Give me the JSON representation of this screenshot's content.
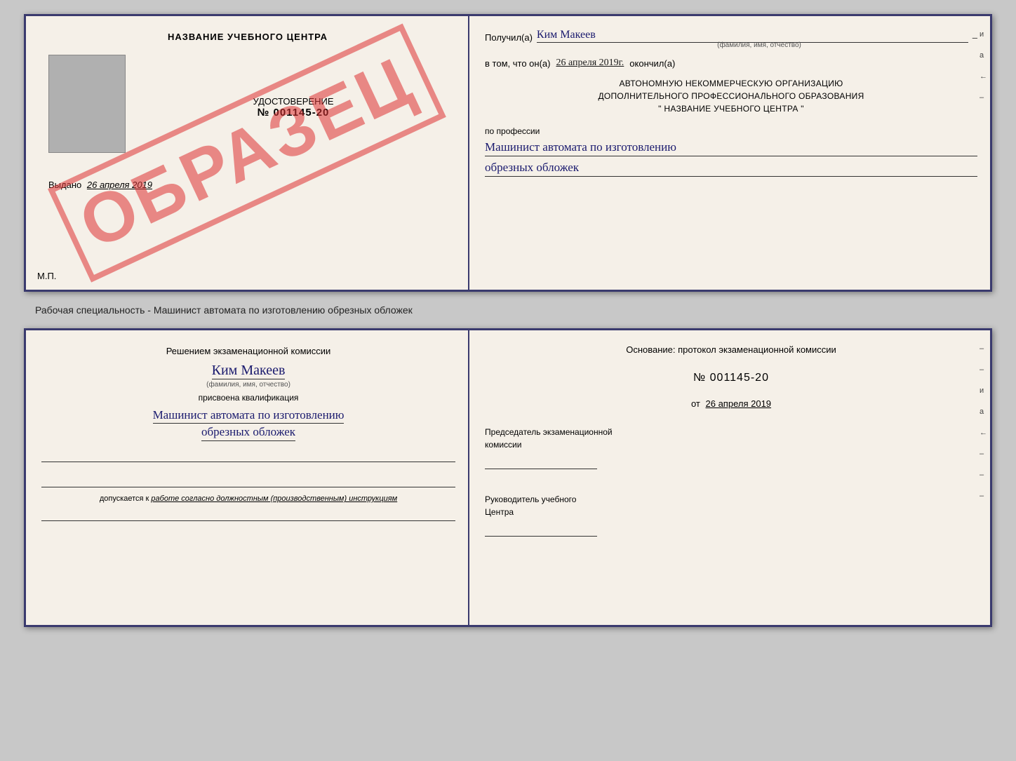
{
  "top_doc": {
    "left": {
      "center_title": "НАЗВАНИЕ УЧЕБНОГО ЦЕНТРА",
      "watermark": "ОБРАЗЕЦ",
      "udostoverenie_label": "УДОСТОВЕРЕНИЕ",
      "number": "№ 001145-20",
      "vydano_label": "Выдано",
      "vydano_date": "26 апреля 2019",
      "mp": "М.П."
    },
    "right": {
      "poluchil_label": "Получил(а)",
      "recipient_name": "Ким Макеев",
      "dash": "–",
      "fio_sub": "(фамилия, имя, отчество)",
      "vtom_label": "в том, что он(а)",
      "date_value": "26 апреля 2019г.",
      "okonchil_label": "окончил(а)",
      "org_line1": "АВТОНОМНУЮ НЕКОММЕРЧЕСКУЮ ОРГАНИЗАЦИЮ",
      "org_line2": "ДОПОЛНИТЕЛЬНОГО ПРОФЕССИОНАЛЬНОГО ОБРАЗОВАНИЯ",
      "org_line3": "\"  НАЗВАНИЕ УЧЕБНОГО ЦЕНТРА  \"",
      "po_professii": "по профессии",
      "profession_line1": "Машинист автомата по изготовлению",
      "profession_line2": "обрезных обложек",
      "dash2": "–",
      "side_marks": [
        "и",
        "а",
        "←",
        "–"
      ]
    }
  },
  "between": {
    "text": "Рабочая специальность - Машинист автомата по изготовлению обрезных обложек"
  },
  "bottom_doc": {
    "left": {
      "komissia_line1": "Решением экзаменационной комиссии",
      "person_name": "Ким Макеев",
      "fio_sub": "(фамилия, имя, отчество)",
      "prisvoena": "присвоена квалификация",
      "qual_line1": "Машинист автомата по изготовлению",
      "qual_line2": "обрезных обложек",
      "dopuskaetsya_prefix": "допускается к ",
      "dopuskaetsya_italic": "работе согласно должностным (производственным) инструкциям"
    },
    "right": {
      "osnov_label": "Основание: протокол экзаменационной комиссии",
      "protocol_num": "№  001145-20",
      "ot_label": "от",
      "ot_date": "26 апреля 2019",
      "predsedatel_line1": "Председатель экзаменационной",
      "predsedatel_line2": "комиссии",
      "rukovoditel_line1": "Руководитель учебного",
      "rukovoditel_line2": "Центра",
      "side_marks": [
        "–",
        "–",
        "и",
        "а",
        "←",
        "–",
        "–",
        "–"
      ]
    }
  }
}
